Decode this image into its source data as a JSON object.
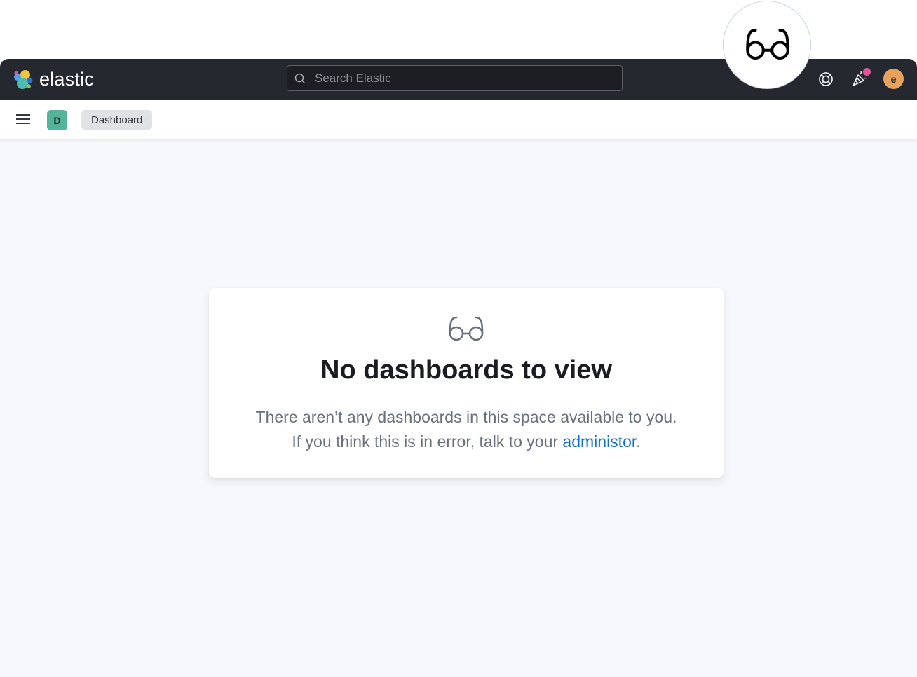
{
  "header": {
    "logo_text": "elastic",
    "search_placeholder": "Search Elastic",
    "icons": [
      "help-lifebuoy-icon",
      "news-feed-party-icon"
    ],
    "notification_dot_color": "#e0569d",
    "user_avatar_initial": "e",
    "user_avatar_color": "#e7a35d"
  },
  "subheader": {
    "space_initial": "D",
    "space_color": "#54b399",
    "breadcrumb": "Dashboard"
  },
  "empty_state": {
    "icon": "glasses-icon",
    "title": "No dashboards to view",
    "line1": "There aren’t any dashboards in this space available to you.",
    "line2_prefix": "If you think this is in error, talk to your ",
    "link_text": "administor",
    "line2_suffix": "."
  },
  "overlay": {
    "icon": "glasses-icon"
  }
}
